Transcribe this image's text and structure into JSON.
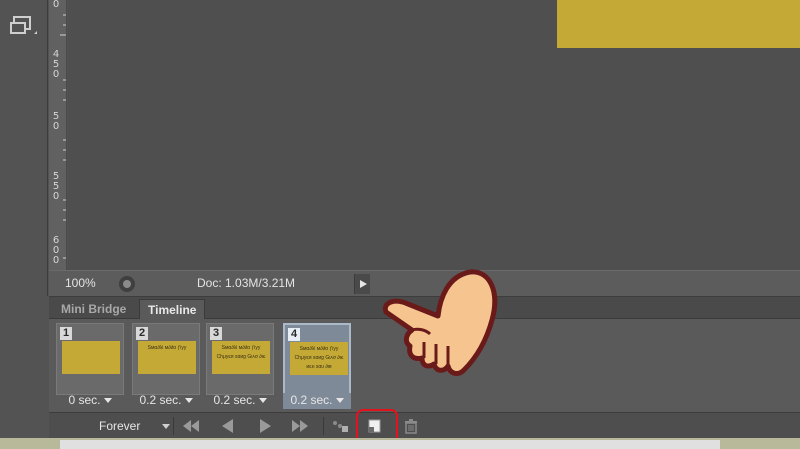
{
  "ruler": {
    "numbers": [
      "0",
      "4",
      "5",
      "0",
      "5",
      "0",
      "5",
      "5",
      "0",
      "6",
      "0",
      "0"
    ]
  },
  "status_bar": {
    "zoom": "100%",
    "doc_info": "Doc: 1.03M/3.21M"
  },
  "panel": {
    "tabs": [
      {
        "label": "Mini Bridge",
        "active": false
      },
      {
        "label": "Timeline",
        "active": true
      }
    ],
    "frames": [
      {
        "number": "1",
        "delay": "0 sec.",
        "selected": false,
        "lines": []
      },
      {
        "number": "2",
        "delay": "0.2 sec.",
        "selected": false,
        "lines": [
          "Ѕмα∂λі м∂∂α ƒіуу"
        ]
      },
      {
        "number": "3",
        "delay": "0.2 sec.",
        "selected": false,
        "lines": [
          "Ѕмα∂λі м∂∂α ƒіуу",
          "Chμуєя sαиg Gιᴀσ ∂ιє"
        ]
      },
      {
        "number": "4",
        "delay": "0.2 sec.",
        "selected": true,
        "lines": [
          "Ѕмα∂λі м∂∂α ƒіуу",
          "Chμуєя sαиg Gιᴀσ ∂ιє",
          "иєн ѕαυ ∂ιʀ"
        ]
      }
    ]
  },
  "controls": {
    "loop_label": "Forever"
  },
  "colors": {
    "accent_yellow": "#c4a937",
    "highlight_red": "#e5121c",
    "hand_fill": "#f6c58f",
    "hand_outline": "#6b1a1a"
  },
  "icons": [
    "screen-mode-icon",
    "first-frame-icon",
    "previous-frame-icon",
    "play-icon",
    "next-frame-icon",
    "tween-icon",
    "duplicate-frame-icon",
    "trash-icon",
    "pointing-hand-icon"
  ]
}
